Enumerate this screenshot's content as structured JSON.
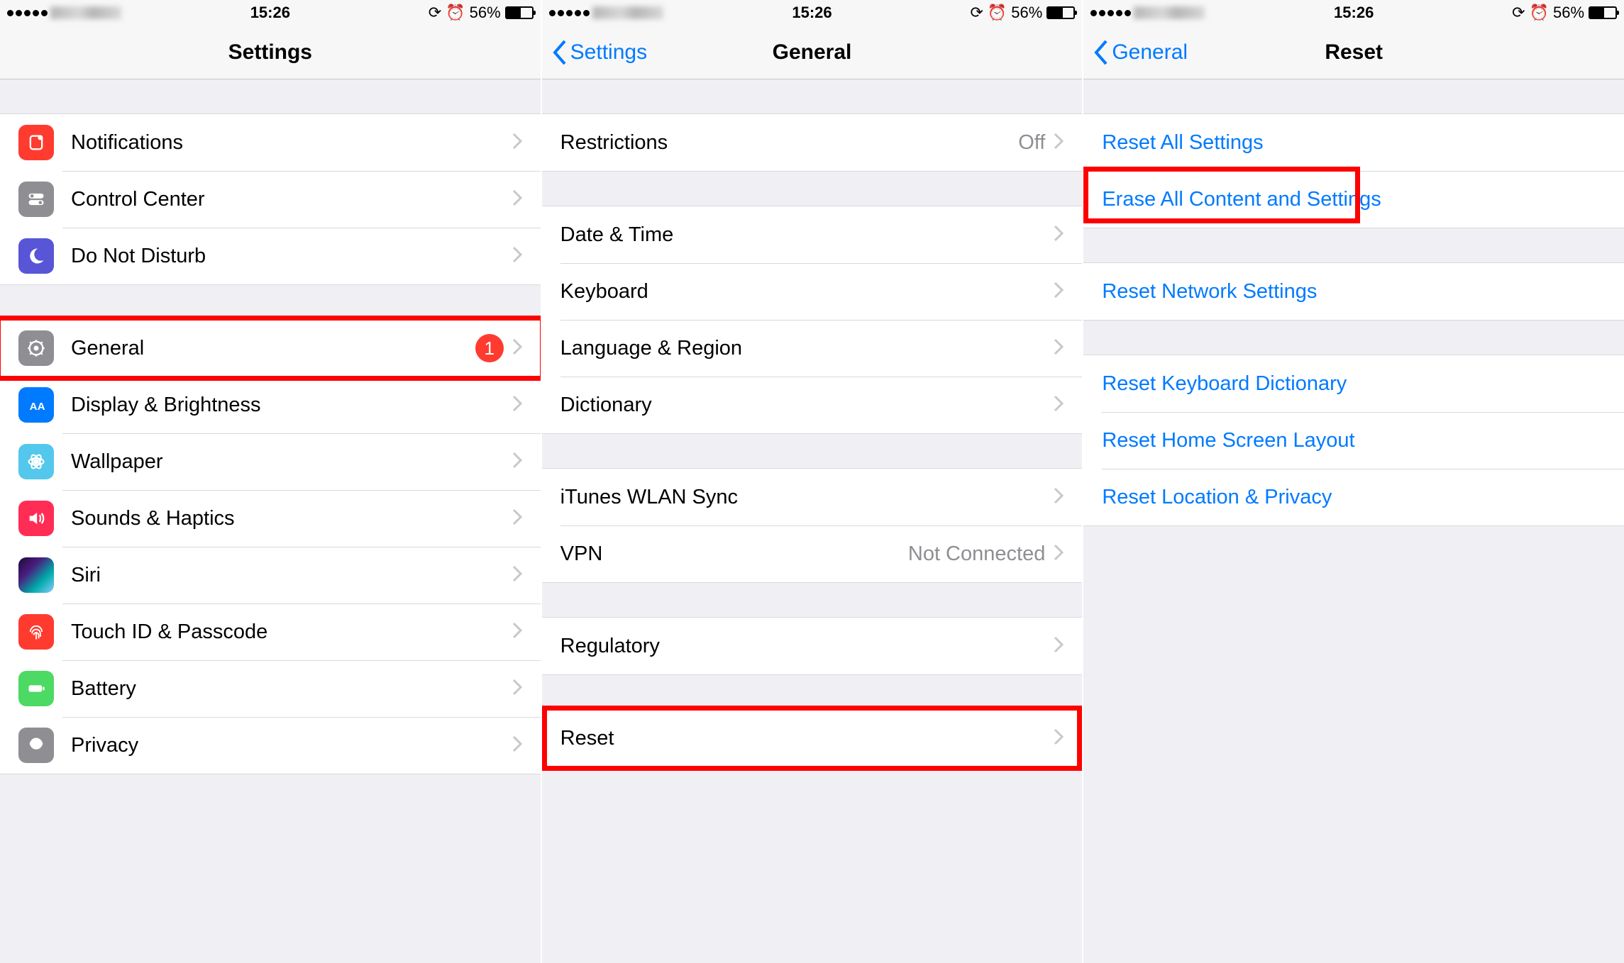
{
  "status": {
    "time": "15:26",
    "battery_pct": "56%",
    "rotation_lock": "⊘",
    "alarm": "⏰"
  },
  "screen1": {
    "title": "Settings",
    "rows": {
      "notifications": "Notifications",
      "control_center": "Control Center",
      "dnd": "Do Not Disturb",
      "general": "General",
      "general_badge": "1",
      "display": "Display & Brightness",
      "wallpaper": "Wallpaper",
      "sounds": "Sounds & Haptics",
      "siri": "Siri",
      "touchid": "Touch ID & Passcode",
      "battery": "Battery",
      "privacy": "Privacy"
    }
  },
  "screen2": {
    "back": "Settings",
    "title": "General",
    "rows": {
      "restrictions": "Restrictions",
      "restrictions_val": "Off",
      "date_time": "Date & Time",
      "keyboard": "Keyboard",
      "language": "Language & Region",
      "dictionary": "Dictionary",
      "itunes": "iTunes WLAN Sync",
      "vpn": "VPN",
      "vpn_val": "Not Connected",
      "regulatory": "Regulatory",
      "reset": "Reset"
    }
  },
  "screen3": {
    "back": "General",
    "title": "Reset",
    "rows": {
      "reset_all": "Reset All Settings",
      "erase_all": "Erase All Content and Settings",
      "network": "Reset Network Settings",
      "keyboard_dict": "Reset Keyboard Dictionary",
      "home_layout": "Reset Home Screen Layout",
      "location_privacy": "Reset Location & Privacy"
    }
  }
}
